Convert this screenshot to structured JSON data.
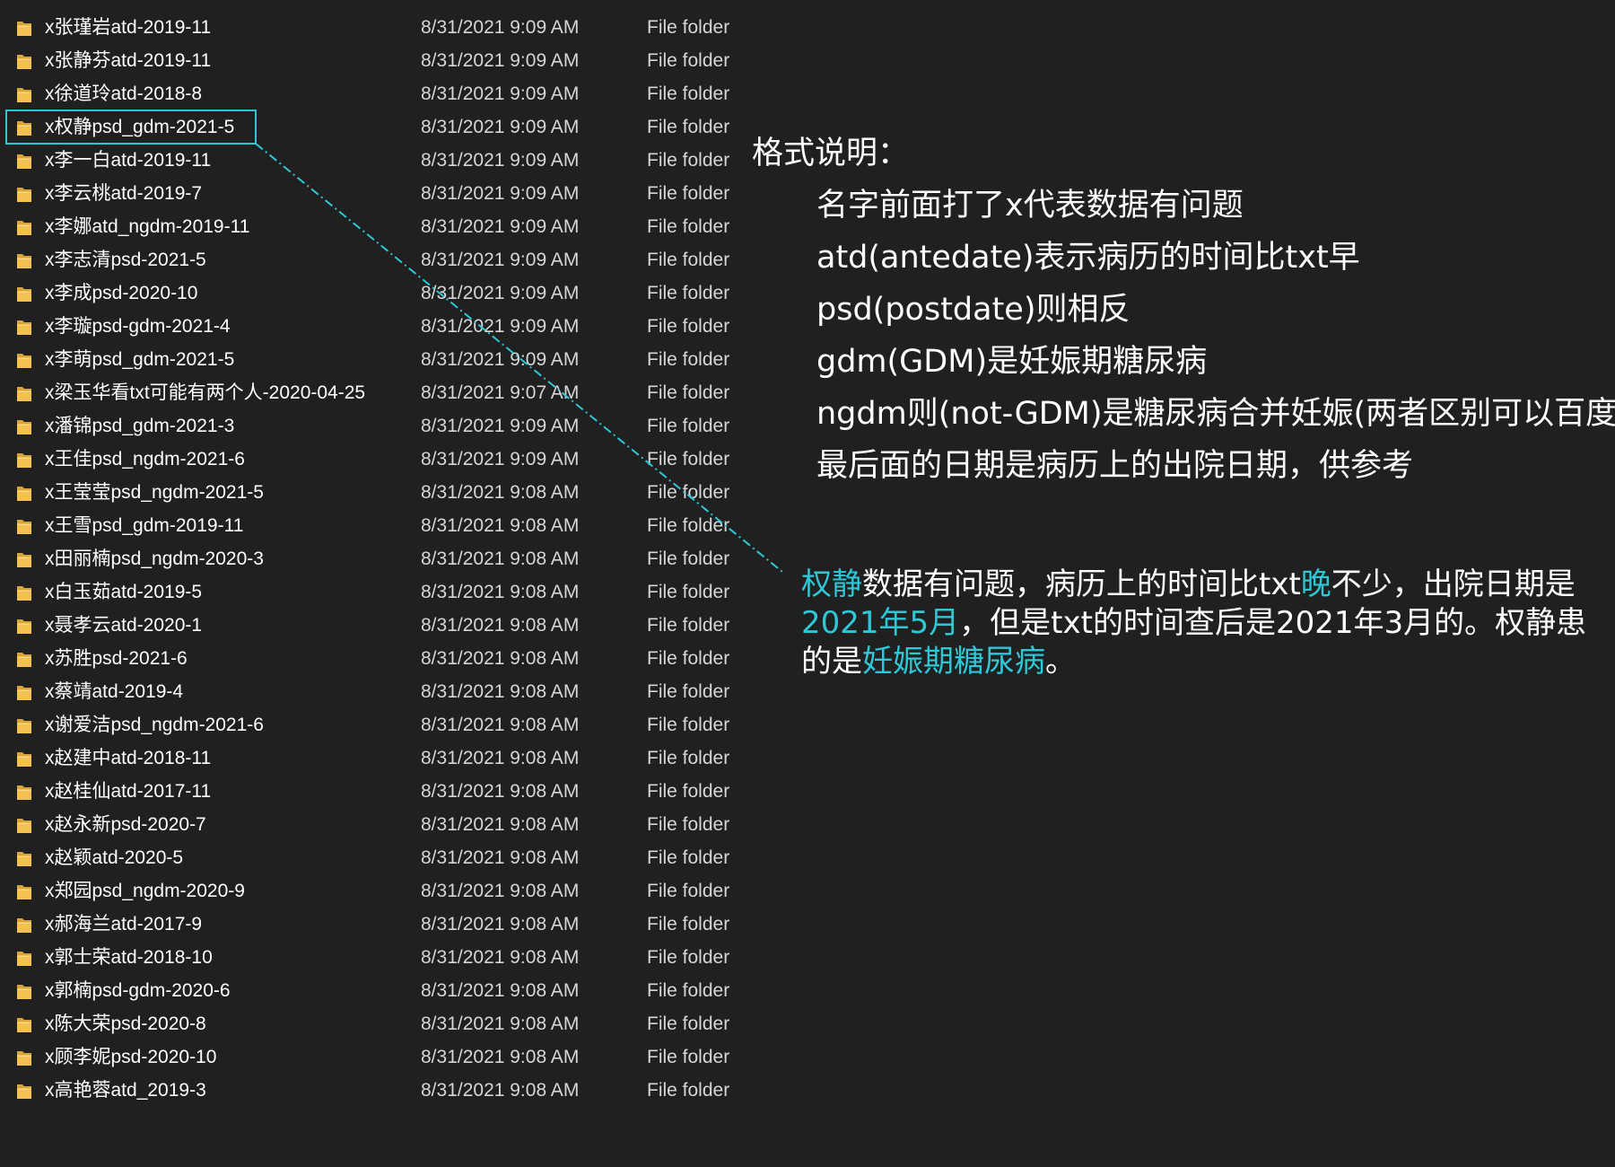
{
  "files": [
    {
      "name": "x张瑾岩atd-2019-11",
      "date": "8/31/2021 9:09 AM",
      "type": "File folder"
    },
    {
      "name": "x张静芬atd-2019-11",
      "date": "8/31/2021 9:09 AM",
      "type": "File folder"
    },
    {
      "name": "x徐道玲atd-2018-8",
      "date": "8/31/2021 9:09 AM",
      "type": "File folder"
    },
    {
      "name": "x权静psd_gdm-2021-5",
      "date": "8/31/2021 9:09 AM",
      "type": "File folder"
    },
    {
      "name": "x李一白atd-2019-11",
      "date": "8/31/2021 9:09 AM",
      "type": "File folder"
    },
    {
      "name": "x李云桃atd-2019-7",
      "date": "8/31/2021 9:09 AM",
      "type": "File folder"
    },
    {
      "name": "x李娜atd_ngdm-2019-11",
      "date": "8/31/2021 9:09 AM",
      "type": "File folder"
    },
    {
      "name": "x李志清psd-2021-5",
      "date": "8/31/2021 9:09 AM",
      "type": "File folder"
    },
    {
      "name": "x李成psd-2020-10",
      "date": "8/31/2021 9:09 AM",
      "type": "File folder"
    },
    {
      "name": "x李璇psd-gdm-2021-4",
      "date": "8/31/2021 9:09 AM",
      "type": "File folder"
    },
    {
      "name": "x李萌psd_gdm-2021-5",
      "date": "8/31/2021 9:09 AM",
      "type": "File folder"
    },
    {
      "name": "x梁玉华看txt可能有两个人-2020-04-25",
      "date": "8/31/2021 9:07 AM",
      "type": "File folder"
    },
    {
      "name": "x潘锦psd_gdm-2021-3",
      "date": "8/31/2021 9:09 AM",
      "type": "File folder"
    },
    {
      "name": "x王佳psd_ngdm-2021-6",
      "date": "8/31/2021 9:09 AM",
      "type": "File folder"
    },
    {
      "name": "x王莹莹psd_ngdm-2021-5",
      "date": "8/31/2021 9:08 AM",
      "type": "File folder"
    },
    {
      "name": "x王雪psd_gdm-2019-11",
      "date": "8/31/2021 9:08 AM",
      "type": "File folder"
    },
    {
      "name": "x田丽楠psd_ngdm-2020-3",
      "date": "8/31/2021 9:08 AM",
      "type": "File folder"
    },
    {
      "name": "x白玉茹atd-2019-5",
      "date": "8/31/2021 9:08 AM",
      "type": "File folder"
    },
    {
      "name": "x聂孝云atd-2020-1",
      "date": "8/31/2021 9:08 AM",
      "type": "File folder"
    },
    {
      "name": "x苏胜psd-2021-6",
      "date": "8/31/2021 9:08 AM",
      "type": "File folder"
    },
    {
      "name": "x蔡靖atd-2019-4",
      "date": "8/31/2021 9:08 AM",
      "type": "File folder"
    },
    {
      "name": "x谢爱洁psd_ngdm-2021-6",
      "date": "8/31/2021 9:08 AM",
      "type": "File folder"
    },
    {
      "name": "x赵建中atd-2018-11",
      "date": "8/31/2021 9:08 AM",
      "type": "File folder"
    },
    {
      "name": "x赵桂仙atd-2017-11",
      "date": "8/31/2021 9:08 AM",
      "type": "File folder"
    },
    {
      "name": "x赵永新psd-2020-7",
      "date": "8/31/2021 9:08 AM",
      "type": "File folder"
    },
    {
      "name": "x赵颖atd-2020-5",
      "date": "8/31/2021 9:08 AM",
      "type": "File folder"
    },
    {
      "name": "x郑园psd_ngdm-2020-9",
      "date": "8/31/2021 9:08 AM",
      "type": "File folder"
    },
    {
      "name": "x郝海兰atd-2017-9",
      "date": "8/31/2021 9:08 AM",
      "type": "File folder"
    },
    {
      "name": "x郭士荣atd-2018-10",
      "date": "8/31/2021 9:08 AM",
      "type": "File folder"
    },
    {
      "name": "x郭楠psd-gdm-2020-6",
      "date": "8/31/2021 9:08 AM",
      "type": "File folder"
    },
    {
      "name": "x陈大荣psd-2020-8",
      "date": "8/31/2021 9:08 AM",
      "type": "File folder"
    },
    {
      "name": "x顾李妮psd-2020-10",
      "date": "8/31/2021 9:08 AM",
      "type": "File folder"
    },
    {
      "name": "x高艳蓉atd_2019-3",
      "date": "8/31/2021 9:08 AM",
      "type": "File folder"
    }
  ],
  "highlighted_index": 3,
  "format_notes": {
    "title": "格式说明：",
    "lines": [
      "名字前面打了x代表数据有问题",
      "atd(antedate)表示病历的时间比txt早",
      "psd(postdate)则相反",
      "gdm(GDM)是妊娠期糖尿病",
      "ngdm则(not-GDM)是糖尿病合并妊娠(两者区别可以百度)",
      "最后面的日期是病历上的出院日期，供参考"
    ]
  },
  "annotation": {
    "segments": [
      {
        "text": "权静",
        "highlight": true
      },
      {
        "text": "数据有问题，病历上的时间比txt",
        "highlight": false
      },
      {
        "text": "晚",
        "highlight": true
      },
      {
        "text": "不少，出院日期是",
        "highlight": false
      },
      {
        "text": "2021年5月",
        "highlight": true
      },
      {
        "text": "，但是txt的时间查后是2021年3月的。权静患的是",
        "highlight": false
      },
      {
        "text": "妊娠期糖尿病",
        "highlight": true
      },
      {
        "text": "。",
        "highlight": false
      }
    ]
  },
  "colors": {
    "background": "#202020",
    "accent": "#2ec7d6",
    "folder": "#f2c14e",
    "text": "#ffffff",
    "secondary_text": "#d6d6d6"
  },
  "icons": {
    "folder": "folder-icon"
  }
}
